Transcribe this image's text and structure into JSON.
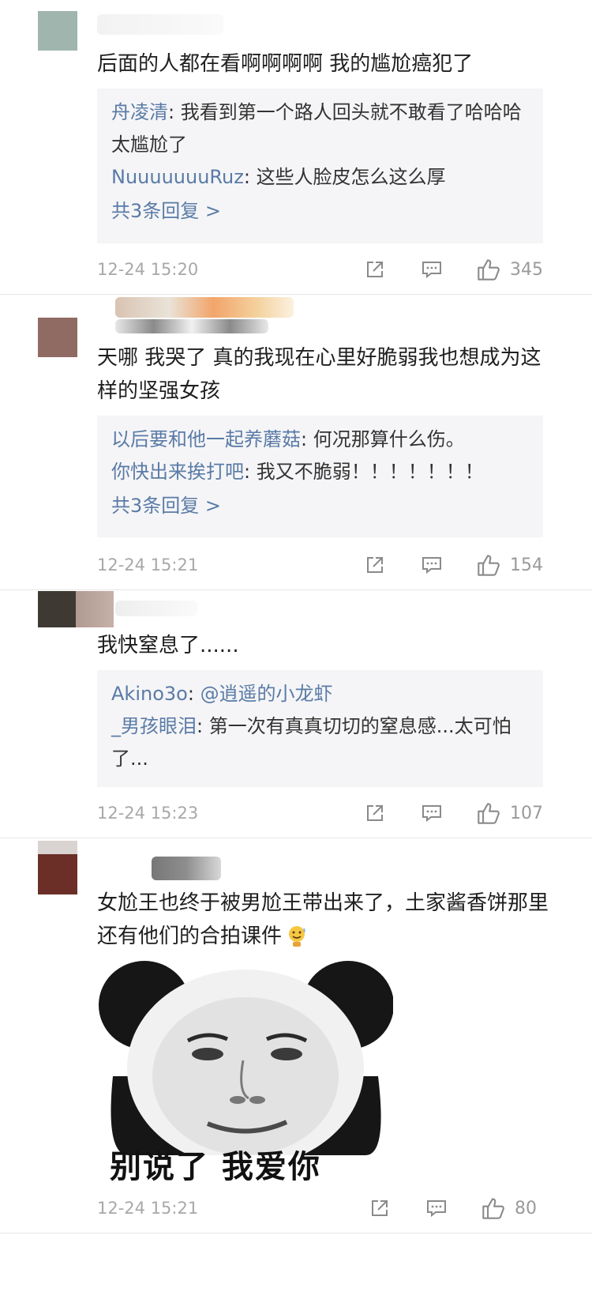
{
  "comments": [
    {
      "text": "后面的人都在看啊啊啊啊 我的尴尬癌犯了",
      "replies": [
        {
          "user": "舟凌清",
          "text": "我看到第一个路人回头就不敢看了哈哈哈太尴尬了"
        },
        {
          "user": "NuuuuuuuRuz",
          "text": "这些人脸皮怎么这么厚"
        }
      ],
      "more_replies": "共3条回复 >",
      "timestamp": "12-24 15:20",
      "likes": "345"
    },
    {
      "text": "天哪 我哭了 真的我现在心里好脆弱我也想成为这样的坚强女孩",
      "replies": [
        {
          "user": "以后要和他一起养蘑菇",
          "text": "何况那算什么伤。"
        },
        {
          "user": "你快出来挨打吧",
          "text": "我又不脆弱！！！！！！！"
        }
      ],
      "more_replies": "共3条回复 >",
      "timestamp": "12-24 15:21",
      "likes": "154"
    },
    {
      "text": "我快窒息了......",
      "replies": [
        {
          "user": "Akino3o",
          "text": "@逍遥的小龙虾"
        },
        {
          "user": "_男孩眼泪",
          "text": "第一次有真真切切的窒息感...太可怕了..."
        }
      ],
      "timestamp": "12-24 15:23",
      "likes": "107"
    },
    {
      "text": "女尬王也终于被男尬王带出来了，土家酱香饼那里还有他们的合拍课件",
      "meme_caption": "别说了  我爱你",
      "timestamp": "12-24 15:21",
      "likes": "80"
    }
  ],
  "colors": {
    "username": "#5a7ba6",
    "timestamp": "#a8a8a8",
    "reply_bg": "#f5f5f7"
  },
  "icons": {
    "share": "share-icon",
    "reply": "comment-icon",
    "like": "thumbs-up-icon",
    "emoji": "sweat-smile-emoji-icon"
  }
}
